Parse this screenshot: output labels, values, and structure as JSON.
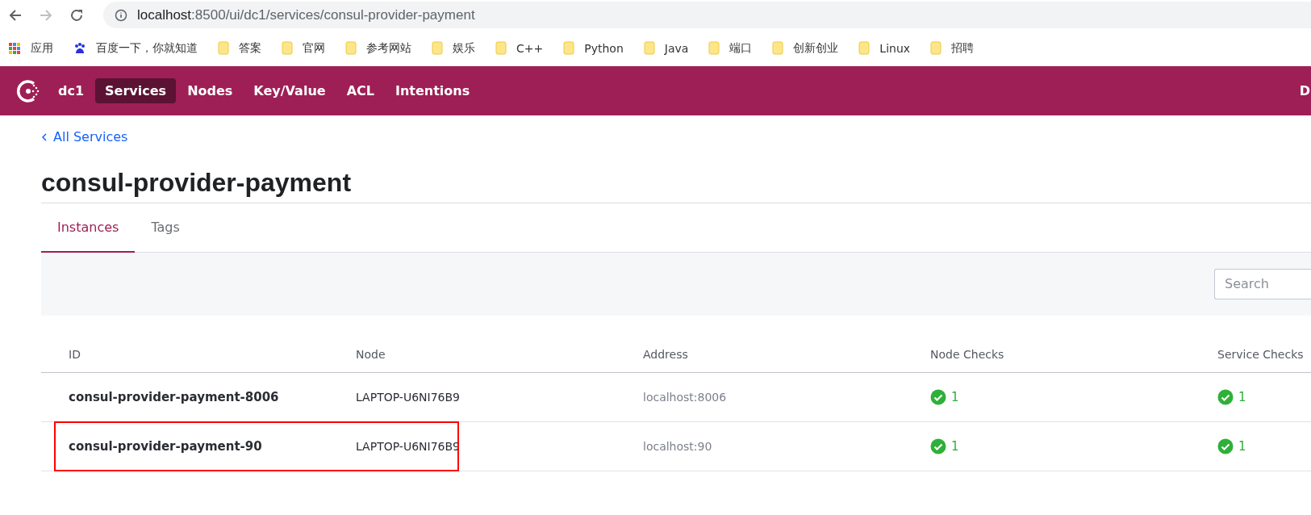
{
  "browser": {
    "url_host": "localhost",
    "url_rest": ":8500/ui/dc1/services/consul-provider-payment"
  },
  "bookmarks": [
    {
      "kind": "apps",
      "label": "应用"
    },
    {
      "kind": "baidu",
      "label": "百度一下，你就知道"
    },
    {
      "kind": "folder",
      "label": "答案"
    },
    {
      "kind": "folder",
      "label": "官网"
    },
    {
      "kind": "folder",
      "label": "参考网站"
    },
    {
      "kind": "folder",
      "label": "娱乐"
    },
    {
      "kind": "folder",
      "label": "C++"
    },
    {
      "kind": "folder",
      "label": "Python"
    },
    {
      "kind": "folder",
      "label": "Java"
    },
    {
      "kind": "folder",
      "label": "端口"
    },
    {
      "kind": "folder",
      "label": "创新创业"
    },
    {
      "kind": "folder",
      "label": "Linux"
    },
    {
      "kind": "folder",
      "label": "招聘"
    }
  ],
  "nav": {
    "datacenter": "dc1",
    "items": [
      {
        "label": "Services",
        "selected": true
      },
      {
        "label": "Nodes",
        "selected": false
      },
      {
        "label": "Key/Value",
        "selected": false
      },
      {
        "label": "ACL",
        "selected": false
      },
      {
        "label": "Intentions",
        "selected": false
      }
    ],
    "right_cut": "D"
  },
  "breadcrumb": "All Services",
  "title": "consul-provider-payment",
  "tabs": [
    {
      "label": "Instances",
      "selected": true
    },
    {
      "label": "Tags",
      "selected": false
    }
  ],
  "search": {
    "placeholder": "Search"
  },
  "table": {
    "columns": [
      "ID",
      "Node",
      "Address",
      "Node Checks",
      "Service Checks"
    ],
    "rows": [
      {
        "id": "consul-provider-payment-8006",
        "node": "LAPTOP-U6NI76B9",
        "address": "localhost:8006",
        "node_checks": "1",
        "service_checks": "1",
        "highlighted": false
      },
      {
        "id": "consul-provider-payment-90",
        "node": "LAPTOP-U6NI76B9",
        "address": "localhost:90",
        "node_checks": "1",
        "service_checks": "1",
        "highlighted": true
      }
    ]
  }
}
